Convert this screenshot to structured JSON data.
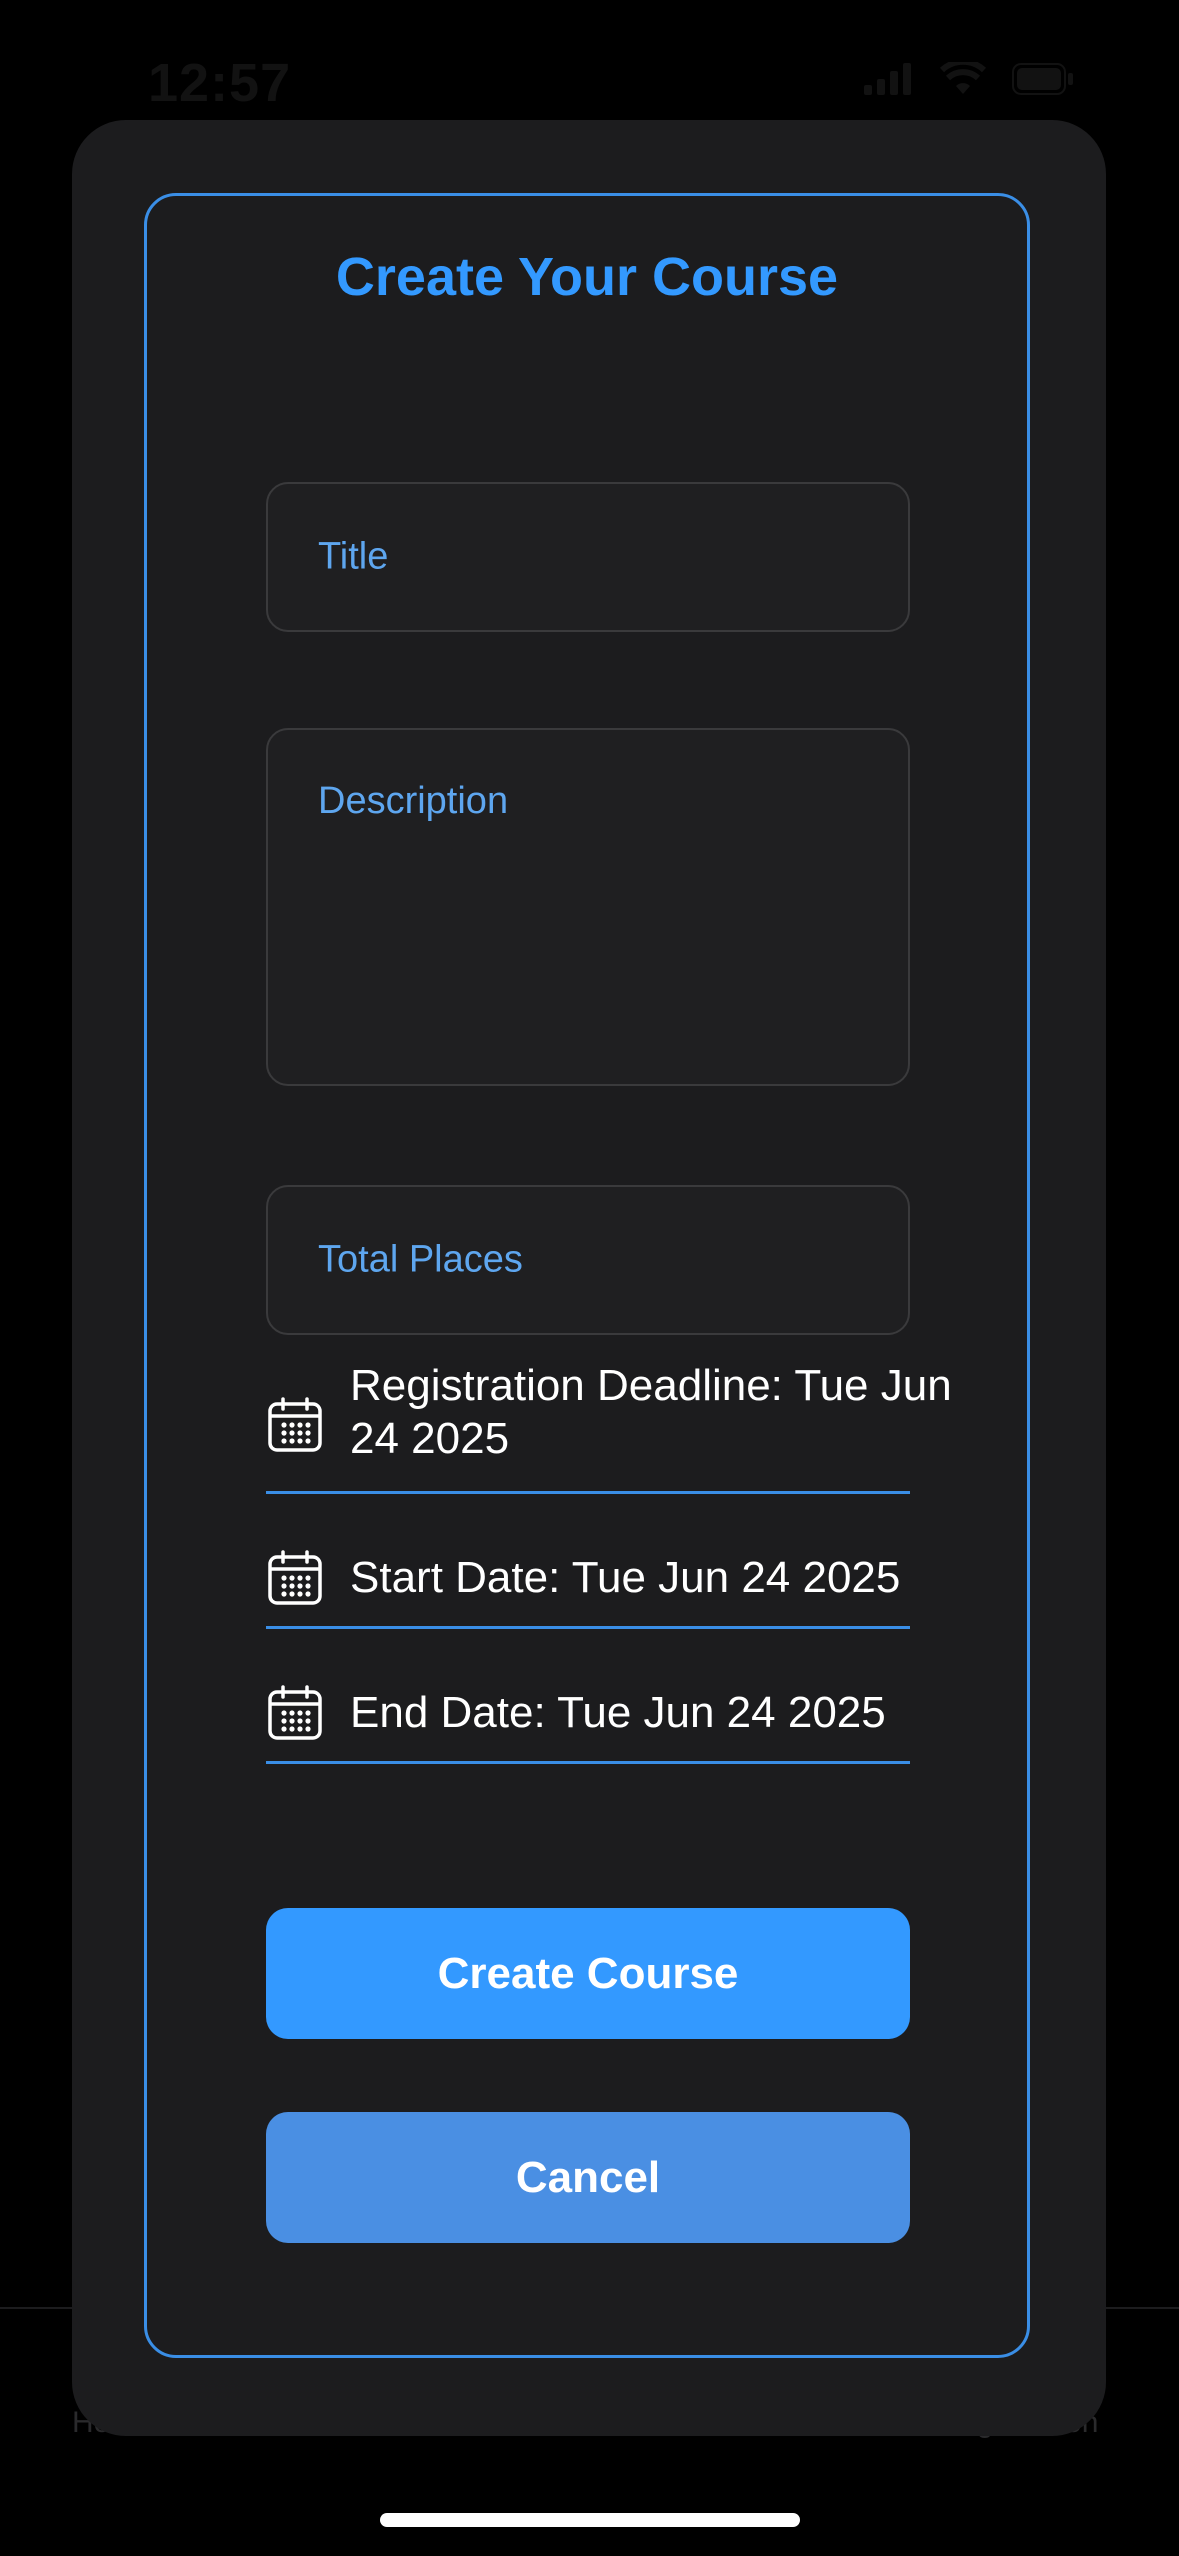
{
  "status_bar": {
    "time": "12:57"
  },
  "background_tabs": {
    "home_partial": "Ho",
    "registration_partial": "egistration"
  },
  "form": {
    "title": "Create Your Course",
    "fields": {
      "title_placeholder": "Title",
      "description_placeholder": "Description",
      "total_places_placeholder": "Total Places"
    },
    "dates": {
      "registration_deadline": "Registration Deadline: Tue Jun 24 2025",
      "start_date": "Start Date: Tue Jun 24 2025",
      "end_date": "End Date: Tue Jun 24 2025"
    },
    "buttons": {
      "create": "Create Course",
      "cancel": "Cancel"
    }
  },
  "colors": {
    "accent": "#3399ff",
    "border_accent": "#3a8ee6",
    "cancel_button": "#4a8fe3",
    "placeholder": "#5ea6ef",
    "sheet_background": "#1c1c1e",
    "page_background": "#000000"
  },
  "icons": {
    "date_field_icon": "calendar-icon",
    "status_icons": [
      "cellular-signal-icon",
      "wifi-icon",
      "battery-icon"
    ]
  }
}
